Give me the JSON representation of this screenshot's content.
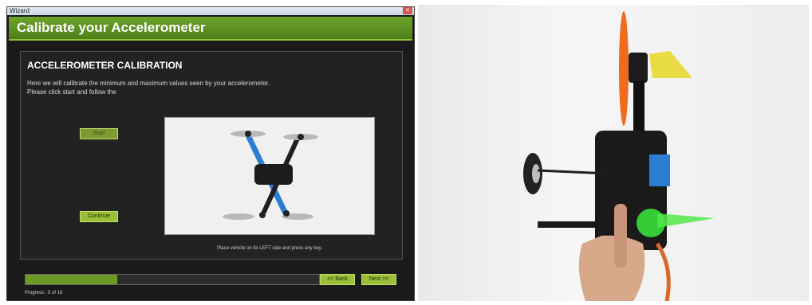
{
  "window": {
    "title": "Wizard",
    "close_glyph": "✕"
  },
  "header": {
    "title": "Calibrate your Accelerometer"
  },
  "panel": {
    "title": "ACCELEROMETER CALIBRATION",
    "description": "Here we will calibrate the minimum and maximum values seen by your accelerometer. Please click start and follow the",
    "start_label": "Start",
    "continue_label": "Continue",
    "instruction": "Place vehicle on its LEFT side and press any key."
  },
  "footer": {
    "progress": {
      "current": 5,
      "total": 16,
      "fraction": 0.3125
    },
    "progress_label": "Progress : 5 of 16",
    "back_label": "<< Back",
    "next_label": "Next >>"
  },
  "colors": {
    "header_green": "#5b8f20",
    "button_green": "#9cbf3a",
    "progress_green": "#6b9b26",
    "drone_arm_blue": "#2a7fd4",
    "propeller_orange": "#f06a1f",
    "led_green": "#37e03a"
  }
}
